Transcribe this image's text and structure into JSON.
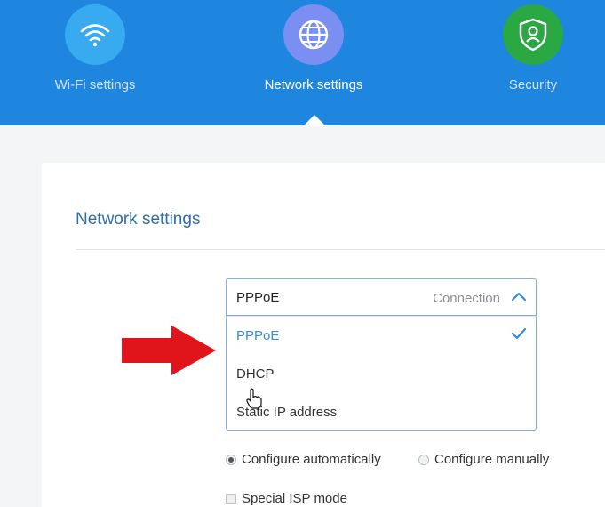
{
  "nav": {
    "items": [
      {
        "label": "Wi-Fi settings",
        "icon": "wifi-icon",
        "color": "#38aaf0"
      },
      {
        "label": "Network settings",
        "icon": "globe-icon",
        "color": "#7b8ff3",
        "active": true
      },
      {
        "label": "Security",
        "icon": "shield-user-icon",
        "color": "#2aa843"
      }
    ]
  },
  "section": {
    "title": "Network settings"
  },
  "connection": {
    "selected": "PPPoE",
    "hint": "Connection",
    "options": [
      "PPPoE",
      "DHCP",
      "Static IP address"
    ]
  },
  "config": {
    "auto_label": "Configure automatically",
    "manual_label": "Configure manually",
    "special_isp_label": "Special ISP mode"
  },
  "colors": {
    "header": "#1f86e0",
    "accent": "#3a8ad6",
    "arrow": "#e0141b"
  }
}
